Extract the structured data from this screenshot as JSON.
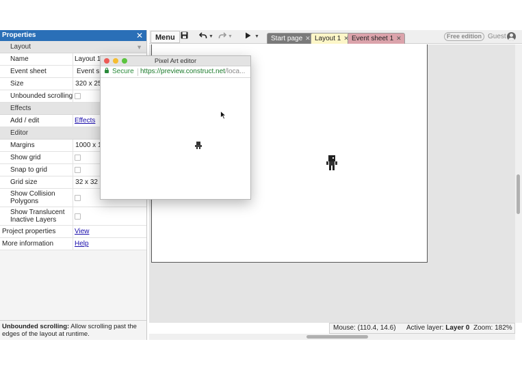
{
  "properties": {
    "title": "Properties",
    "close_label": "✕",
    "sections": {
      "layout": "Layout",
      "effects": "Effects",
      "editor": "Editor"
    },
    "rows": {
      "name": {
        "label": "Name",
        "value": "Layout 1"
      },
      "event_sheet": {
        "label": "Event sheet",
        "value": "Event sheet 1"
      },
      "size": {
        "label": "Size",
        "value": "320 x 256"
      },
      "unbounded_scrolling": {
        "label": "Unbounded scrolling"
      },
      "add_edit": {
        "label": "Add / edit",
        "value": "Effects"
      },
      "margins": {
        "label": "Margins",
        "value": "1000 x 1000"
      },
      "show_grid": {
        "label": "Show grid"
      },
      "snap_to_grid": {
        "label": "Snap to grid"
      },
      "grid_size": {
        "label": "Grid size",
        "value": "32 x 32"
      },
      "show_collision": {
        "label": "Show Collision Polygons"
      },
      "show_translucent": {
        "label": "Show Translucent Inactive Layers"
      },
      "project_properties": {
        "label": "Project properties",
        "value": "View"
      },
      "more_information": {
        "label": "More information",
        "value": "Help"
      }
    },
    "help": {
      "term": "Unbounded scrolling:",
      "text": " Allow scrolling past the edges of the layout at runtime."
    }
  },
  "toolbar": {
    "menu_label": "Menu",
    "icons": [
      "save-icon",
      "undo-icon",
      "redo-icon",
      "play-icon"
    ],
    "tabs": [
      {
        "label": "Start page",
        "close": "✕"
      },
      {
        "label": "Layout 1",
        "close": "✕"
      },
      {
        "label": "Event sheet 1",
        "close": "✕"
      }
    ],
    "edition_badge": "Free edition",
    "guest_label": "Guest"
  },
  "popup": {
    "title": "Pixel Art editor",
    "secure_label": "Secure",
    "url_scheme_host": "https://preview.construct.net",
    "url_rest": "/loca..."
  },
  "status": {
    "mouse_label": "Mouse:",
    "mouse_value": "(110.4, 14.6)",
    "layer_label": "Active layer:",
    "layer_value": "Layer 0",
    "zoom_label": "Zoom:",
    "zoom_value": "182%"
  },
  "colors": {
    "panel_header": "#2a6fb7",
    "tab_start": "#7a7a7a",
    "tab_layout": "#fdf6c8",
    "tab_event": "#dba3ab",
    "secure_green": "#2a8a3a"
  }
}
